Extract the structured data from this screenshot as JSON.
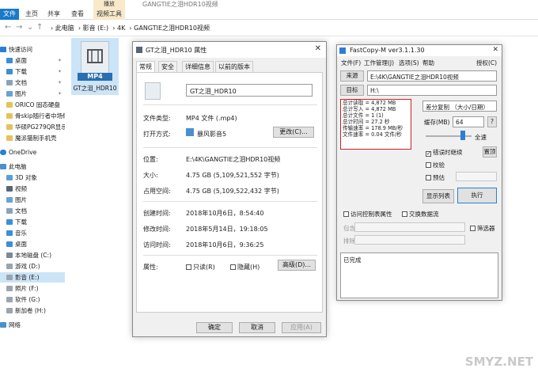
{
  "explorer": {
    "context_tab": "播放",
    "window_title": "GANGTIE之泪HDR10视频",
    "ribbon": {
      "file": "文件",
      "home": "主页",
      "share": "共享",
      "view": "查看",
      "video_tools": "视频工具"
    },
    "breadcrumb": [
      "此电脑",
      "影音 (E:)",
      "4K",
      "GANGTIE之泪HDR10视频"
    ],
    "sidebar": [
      {
        "label": "快速访问",
        "pin": false
      },
      {
        "label": "桌面",
        "pin": true
      },
      {
        "label": "下载",
        "pin": true
      },
      {
        "label": "文档",
        "pin": true
      },
      {
        "label": "图片",
        "pin": true
      },
      {
        "label": "ORICO 固态硬盘",
        "pin": false
      },
      {
        "label": "骨skip随行者中场倒",
        "pin": false
      },
      {
        "label": "华硕PG279QR显示",
        "pin": false
      },
      {
        "label": "魔派猫制手机壳",
        "pin": false
      },
      {
        "label": "OneDrive",
        "pin": false
      },
      {
        "label": "此电脑",
        "pin": false
      },
      {
        "label": "3D 对象",
        "pin": false
      },
      {
        "label": "视频",
        "pin": false
      },
      {
        "label": "图片",
        "pin": false
      },
      {
        "label": "文档",
        "pin": false
      },
      {
        "label": "下载",
        "pin": false
      },
      {
        "label": "音乐",
        "pin": false
      },
      {
        "label": "桌面",
        "pin": false
      },
      {
        "label": "本地磁盘 (C:)",
        "pin": false
      },
      {
        "label": "游戏 (D:)",
        "pin": false
      },
      {
        "label": "影音 (E:)",
        "pin": false
      },
      {
        "label": "照片 (F:)",
        "pin": false
      },
      {
        "label": "软件 (G:)",
        "pin": false
      },
      {
        "label": "新加卷 (H:)",
        "pin": false
      },
      {
        "label": "网络",
        "pin": false
      }
    ],
    "file": {
      "badge": "MP4",
      "name": "GT之泪_HDR10"
    }
  },
  "props": {
    "title": "GT之泪_HDR10 属性",
    "tabs": [
      "常规",
      "安全",
      "详细信息",
      "以前的版本"
    ],
    "filename": "GT之泪_HDR10",
    "type_label": "文件类型:",
    "type_value": "MP4 文件 (.mp4)",
    "open_label": "打开方式:",
    "open_value": "暴风影音5",
    "change_btn": "更改(C)...",
    "location_label": "位置:",
    "location_value": "E:\\4K\\GANGTIE之泪HDR10视频",
    "size_label": "大小:",
    "size_value": "4.75 GB (5,109,521,552 字节)",
    "disk_label": "占用空间:",
    "disk_value": "4.75 GB (5,109,522,432 字节)",
    "created_label": "创建时间:",
    "created_value": "2018年10月6日，8:54:40",
    "modified_label": "修改时间:",
    "modified_value": "2018年5月14日，19:18:05",
    "accessed_label": "访问时间:",
    "accessed_value": "2018年10月6日，9:36:25",
    "attr_label": "属性:",
    "readonly": "只读(R)",
    "hidden": "隐藏(H)",
    "advanced_btn": "高级(D)...",
    "ok": "确定",
    "cancel": "取消",
    "apply": "应用(A)"
  },
  "fastcopy": {
    "title": "FastCopy-M ver3.1.1.30",
    "menu": [
      "文件(F)",
      "工作管理(J)",
      "选项(S)",
      "帮助",
      "授权(C)"
    ],
    "source_btn": "来源",
    "source_value": "E:\\4K\\GANGTIE之泪HDR10视频",
    "dest_btn": "目标",
    "dest_value": "H:\\",
    "stats": [
      "总计读取 = 4,872 MB",
      "总计写入 = 4,872 MB",
      "总计文件 = 1 (1)",
      "总计时间 = 27.2 秒",
      "传输速率 = 178.9 MB/秒",
      "文件速率 = 0.04 文件/秒"
    ],
    "mode": "差分复制 （大小/日期）",
    "buffer_label": "缓存(MB)",
    "buffer_value": "64",
    "help": "?",
    "full_speed": "全速",
    "continue_err": "错误时继续",
    "verify": "校验",
    "estimate": "预估",
    "preview": "置顶",
    "list_btn": "显示列表",
    "exec_btn": "执行",
    "acl": "访问控制表属性",
    "ads": "交换数据流",
    "include": "包含",
    "exclude": "排除",
    "filter": "筛选器",
    "status": "已完成"
  },
  "watermark": "SMYZ.NET"
}
